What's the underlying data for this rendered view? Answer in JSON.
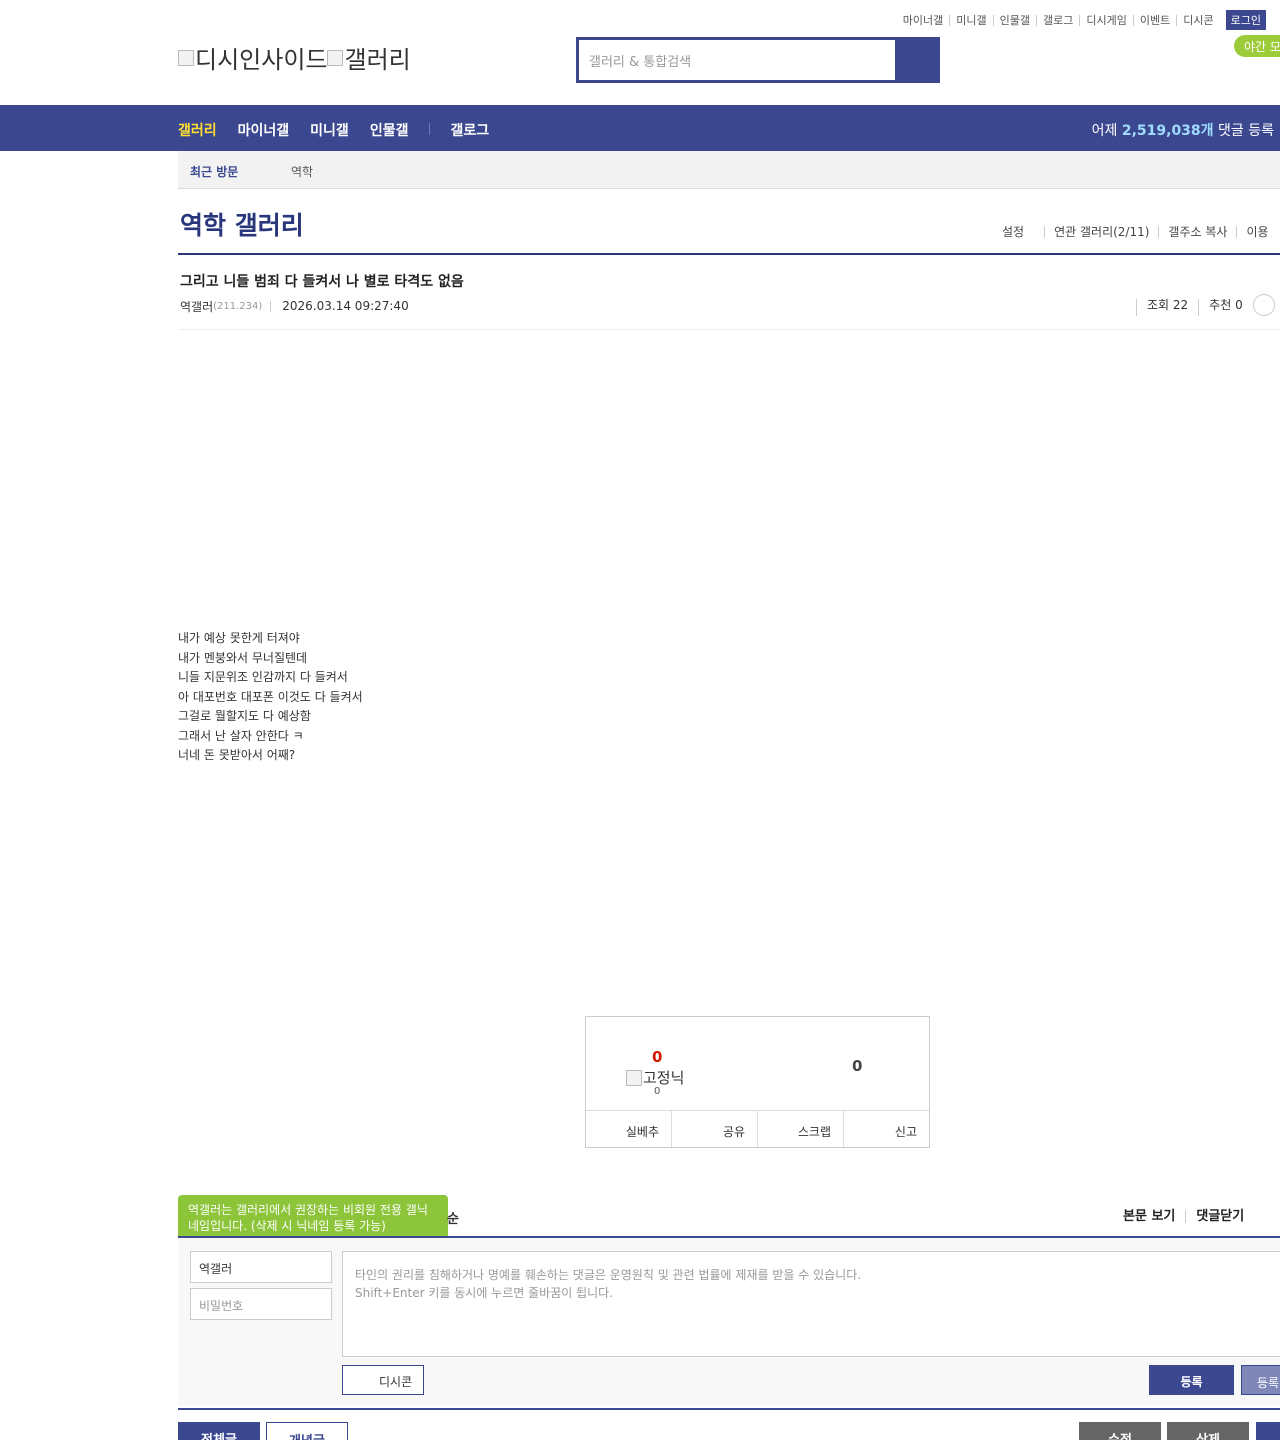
{
  "util_links": [
    "마이너갤",
    "미니갤",
    "인물갤",
    "갤로그",
    "디시게임",
    "이벤트",
    "디시콘"
  ],
  "login_label": "로그인",
  "night_mode_label": "야간 모",
  "logo": {
    "left_text": "디시인사이드",
    "right_text": "갤러리"
  },
  "search": {
    "placeholder": "갤러리 & 통합검색"
  },
  "gnb": {
    "items": [
      "갤러리",
      "마이너갤",
      "미니갤",
      "인물갤",
      "갤로그"
    ],
    "stat_prefix": "어제",
    "stat_value": "2,519,038개",
    "stat_suffix": "댓글 등록"
  },
  "recent": {
    "label": "최근 방문",
    "item": "역학"
  },
  "gallery": {
    "title": "역학 갤러리",
    "tools": [
      "설정",
      "연관 갤러리(2/11)",
      "갤주소 복사",
      "이용"
    ]
  },
  "post": {
    "title": "그리고 니들 범죄 다 들켜서 나 별로 타격도 없음",
    "author": "역갤러",
    "ip": "(211.234)",
    "date": "2026.03.14 09:27:40",
    "views": "조회 22",
    "recommend": "추천 0",
    "body": [
      "내가 예상 못한게 터져야",
      "내가 멘붕와서 무너질텐데",
      "니들 지문위조 인감까지 다 들켜서",
      "아 대포번호 대포폰 이것도 다 들켜서",
      "그걸로 뭘할지도 다 예상함",
      "그래서 난 살자 안한다 ㅋ",
      "너네 돈 못받아서 어째?"
    ]
  },
  "recommend_box": {
    "up_count": "0",
    "fixed_nick_label": "고정닉",
    "fixed_nick_count": "0",
    "down_count": "0",
    "buttons": [
      "실베추",
      "공유",
      "스크랩",
      "신고"
    ]
  },
  "comment": {
    "tooltip": "역갤러는 갤러리에서 권장하는 비회원 전용 갤닉네임입니다. (삭제 시 닉네임 등록 가능)",
    "tooltip_tail": "순",
    "tabs": [
      "본문 보기",
      "댓글닫기"
    ],
    "name_value": "역갤러",
    "password_placeholder": "비밀번호",
    "textarea_placeholder": "타인의 권리를 침해하거나 명예를 훼손하는 댓글은 운영원칙 및 관련 법률에 제재를 받을 수 있습니다.\nShift+Enter 키를 동시에 누르면 줄바꿈이 됩니다.",
    "dccon_label": "디시콘",
    "register_label": "등록",
    "register2_label": "등록"
  },
  "bottom": {
    "all_label": "전체글",
    "concept_label": "개념글",
    "edit_label": "수정",
    "delete_label": "삭제"
  }
}
